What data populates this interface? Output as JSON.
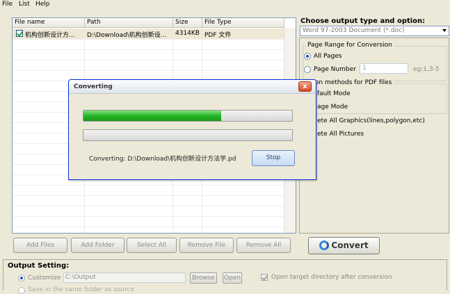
{
  "menu": [
    "File",
    "List",
    "Help"
  ],
  "file_list": {
    "columns": [
      "File name",
      "Path",
      "Size",
      "File Type"
    ],
    "rows": [
      {
        "name": "机构创新设计方...",
        "path": "D:\\Download\\机构创新设...",
        "size": "4314KB",
        "type": "PDF 文件",
        "checked": true
      }
    ]
  },
  "right_panel": {
    "title": "Choose output type and option:",
    "output_type": "Word 97-2003 Document (*.doc)",
    "page_range": {
      "title": "Page Range for Conversion",
      "all_pages": "All Pages",
      "page_number": "Page Number",
      "page_number_value": "1",
      "example": "eg:1,3-5"
    },
    "methods": {
      "title": "rsion methods for PDF files",
      "default_mode": "fault Mode",
      "page_mode": "age Mode"
    },
    "delete_graphics": "ete All Graphics(lines,polygon,etc)",
    "delete_pictures": "ete All Pictures"
  },
  "buttons": {
    "add_files": "Add Files",
    "add_folder": "Add Folder",
    "select_all": "Select All",
    "remove_file": "Remove File",
    "remove_all": "Remove All",
    "convert": "Convert"
  },
  "output_setting": {
    "title": "Output Setting:",
    "customize": "Customize",
    "directory": "C:\\Output",
    "browse": "Browse",
    "open": "Open",
    "open_after": "Open target directory after conversion",
    "same_folder": "Save in the same folder as source"
  },
  "dialog": {
    "title": "Converting",
    "close": "x",
    "progress_current": 0.66,
    "progress_total": 0.0,
    "status": "Converting:  D:\\Download\\机构创新设计方法学.pd",
    "stop": "Stop"
  },
  "colors": {
    "accent_green": "#22b022",
    "dialog_border": "#0831d9",
    "close_red": "#d24822"
  }
}
